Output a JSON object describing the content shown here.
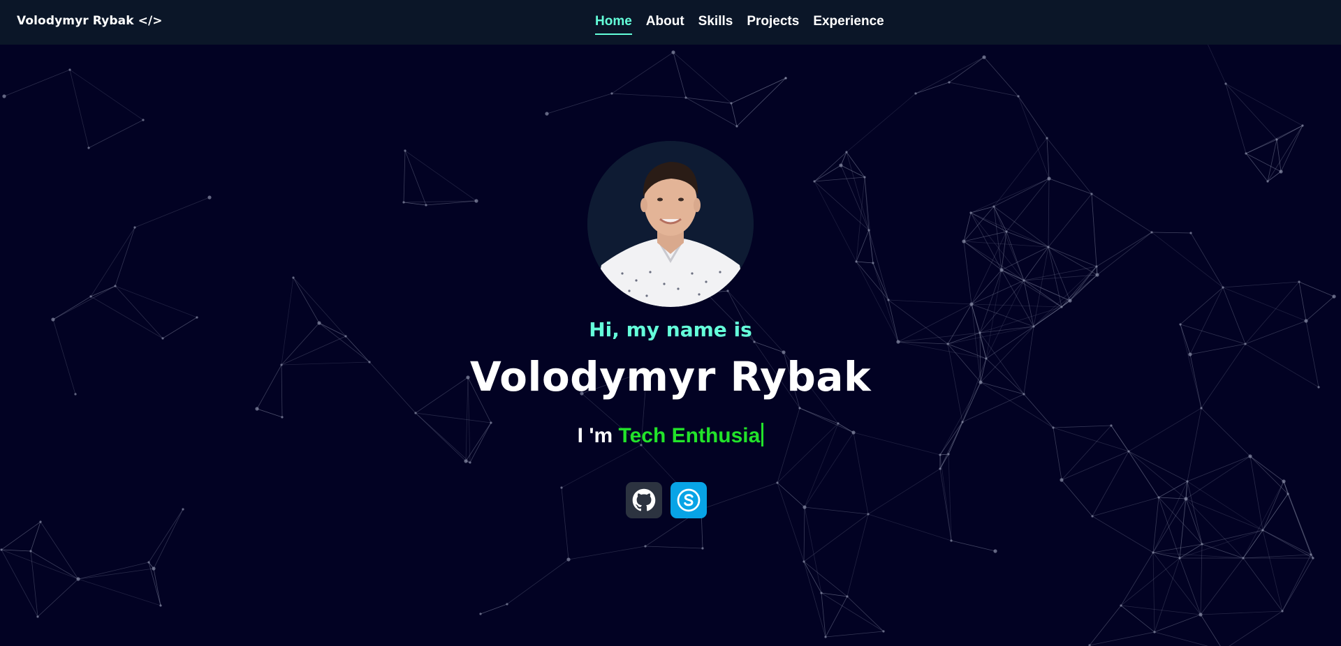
{
  "nav": {
    "brand": "Volodymyr Rybak </>",
    "links": [
      {
        "label": "Home",
        "active": true
      },
      {
        "label": "About",
        "active": false
      },
      {
        "label": "Skills",
        "active": false
      },
      {
        "label": "Projects",
        "active": false
      },
      {
        "label": "Experience",
        "active": false
      }
    ]
  },
  "hero": {
    "greeting": "Hi, my name is",
    "name": "Volodymyr Rybak",
    "tagline_prefix": "I 'm",
    "tagline_typed": "Tech Enthusia",
    "avatar_icon": "profile-photo"
  },
  "socials": [
    {
      "name": "GitHub",
      "icon": "github-icon",
      "color": "#2c3340"
    },
    {
      "name": "Skype",
      "icon": "skype-icon",
      "color": "#08a4e6"
    }
  ],
  "colors": {
    "background": "#020223",
    "navbar": "#0b1628",
    "accent": "#64ffda",
    "typed": "#22e32a"
  }
}
